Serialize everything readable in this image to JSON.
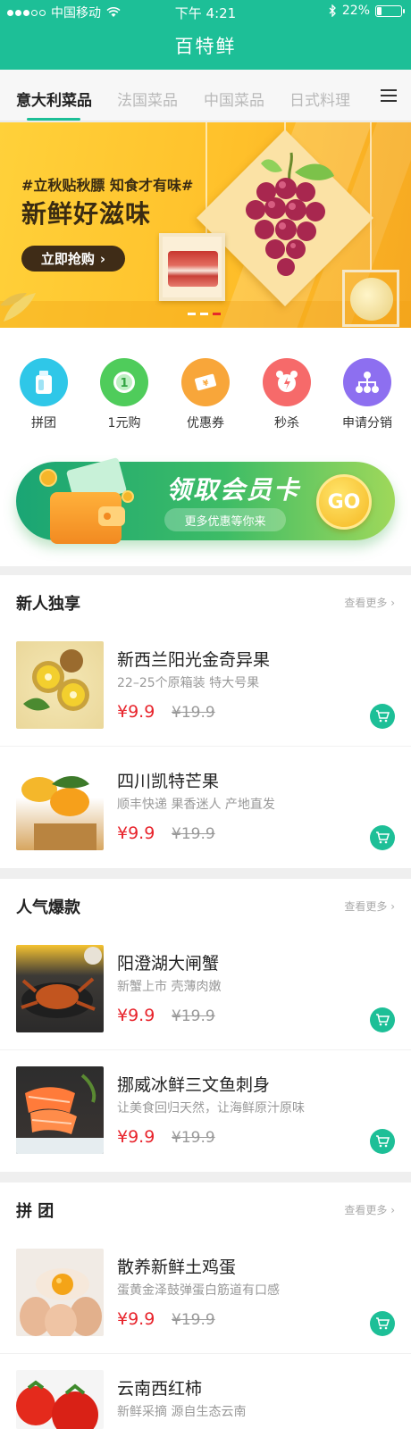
{
  "status_bar": {
    "carrier": "中国移动",
    "time": "下午 4:21",
    "battery": "22%",
    "battery_level": 0.22
  },
  "app": {
    "title": "百特鲜"
  },
  "tabs": [
    {
      "label": "意大利菜品",
      "active": true
    },
    {
      "label": "法国菜品",
      "active": false
    },
    {
      "label": "中国菜品",
      "active": false
    },
    {
      "label": "日式料理",
      "active": false
    }
  ],
  "banner": {
    "tag": "#立秋贴秋膘 知食才有味#",
    "headline": "新鲜好滋味",
    "button": "立即抢购",
    "slides": 3,
    "active_slide": 3
  },
  "quick_links": [
    {
      "label": "拼团",
      "icon": "bottle-icon",
      "color": "#2fc7e8"
    },
    {
      "label": "1元购",
      "icon": "one-coin-icon",
      "color": "#4fcc5b"
    },
    {
      "label": "优惠券",
      "icon": "ticket-icon",
      "color": "#f8a63a"
    },
    {
      "label": "秒杀",
      "icon": "alarm-icon",
      "color": "#f66a6a"
    },
    {
      "label": "申请分销",
      "icon": "network-icon",
      "color": "#8d6ff0"
    }
  ],
  "member": {
    "title": "领取会员卡",
    "subtitle": "更多优惠等你来",
    "go": "GO"
  },
  "sections": [
    {
      "title": "新人独享",
      "more": "查看更多",
      "products": [
        {
          "name": "新西兰阳光金奇异果",
          "desc": "22–25个原箱装 特大号果",
          "price": "¥9.9",
          "old": "¥19.9",
          "image": "kiwi"
        },
        {
          "name": "四川凯特芒果",
          "desc": "顺丰快递 果香迷人 产地直发",
          "price": "¥9.9",
          "old": "¥19.9",
          "image": "mango"
        }
      ]
    },
    {
      "title": "人气爆款",
      "more": "查看更多",
      "products": [
        {
          "name": "阳澄湖大闸蟹",
          "desc": "新蟹上市 壳薄肉嫩",
          "price": "¥9.9",
          "old": "¥19.9",
          "image": "crab"
        },
        {
          "name": "挪威冰鲜三文鱼刺身",
          "desc": "让美食回归天然，让海鲜原汁原味",
          "price": "¥9.9",
          "old": "¥19.9",
          "image": "salmon"
        }
      ]
    },
    {
      "title": "拼 团",
      "more": "查看更多",
      "products": [
        {
          "name": "散养新鲜土鸡蛋",
          "desc": "蛋黄金泽鼓弹蛋白筋道有口感",
          "price": "¥9.9",
          "old": "¥19.9",
          "image": "egg"
        },
        {
          "name": "云南西红柿",
          "desc": "新鲜采摘 源自生态云南",
          "price": "",
          "old": "",
          "image": "tomato"
        }
      ]
    }
  ]
}
